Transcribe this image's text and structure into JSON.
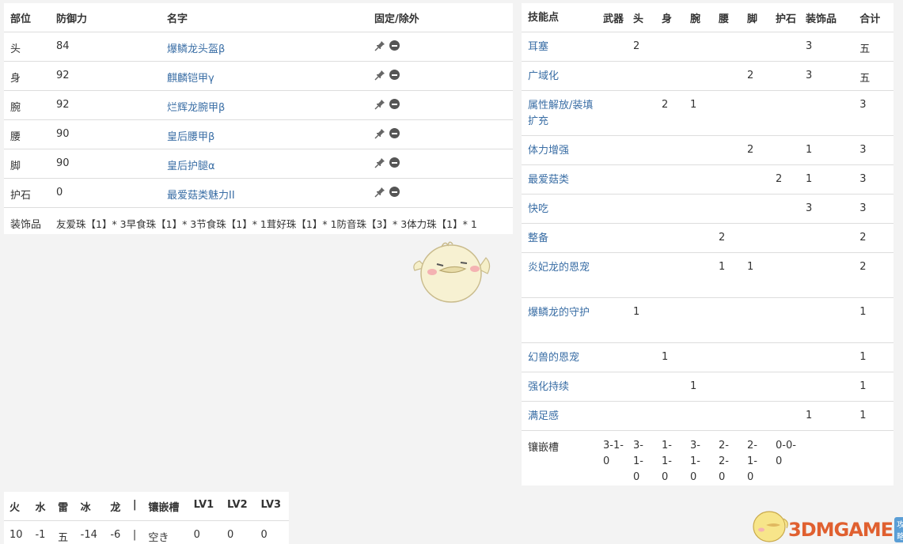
{
  "equipment": {
    "headers": [
      "部位",
      "防御力",
      "名字",
      "固定/除外"
    ],
    "rows": [
      {
        "part": "头",
        "defense": "84",
        "name": "爆鳞龙头盔β"
      },
      {
        "part": "身",
        "defense": "92",
        "name": "麒麟铠甲γ"
      },
      {
        "part": "腕",
        "defense": "92",
        "name": "烂辉龙腕甲β"
      },
      {
        "part": "腰",
        "defense": "90",
        "name": "皇后腰甲β"
      },
      {
        "part": "脚",
        "defense": "90",
        "name": "皇后护腿α"
      },
      {
        "part": "护石",
        "defense": "0",
        "name": "最爱菇类魅力II"
      }
    ],
    "deco_label": "装饰品",
    "deco_text": "友爱珠【1】* 3早食珠【1】* 3节食珠【1】* 1茸好珠【1】* 1防音珠【3】* 3体力珠【1】* 1"
  },
  "skills": {
    "headers": [
      "技能点",
      "武器",
      "头",
      "身",
      "腕",
      "腰",
      "脚",
      "护石",
      "装饰品",
      "合计"
    ],
    "rows": [
      {
        "name": "耳塞",
        "cells": [
          "",
          "2",
          "",
          "",
          "",
          "",
          "",
          "3",
          "五"
        ]
      },
      {
        "name": "广域化",
        "cells": [
          "",
          "",
          "",
          "",
          "",
          "2",
          "",
          "3",
          "五"
        ]
      },
      {
        "name": "属性解放/装填扩充",
        "cells": [
          "",
          "",
          "2",
          "1",
          "",
          "",
          "",
          "",
          "3"
        ]
      },
      {
        "name": "体力增强",
        "cells": [
          "",
          "",
          "",
          "",
          "",
          "2",
          "",
          "1",
          "3"
        ]
      },
      {
        "name": "最爱菇类",
        "cells": [
          "",
          "",
          "",
          "",
          "",
          "",
          "2",
          "1",
          "3"
        ]
      },
      {
        "name": "快吃",
        "cells": [
          "",
          "",
          "",
          "",
          "",
          "",
          "",
          "3",
          "3"
        ]
      },
      {
        "name": "整备",
        "cells": [
          "",
          "",
          "",
          "",
          "2",
          "",
          "",
          "",
          "2"
        ]
      },
      {
        "name": "炎妃龙的恩宠",
        "cells": [
          "",
          "",
          "",
          "",
          "1",
          "1",
          "",
          "",
          "2"
        ]
      },
      {
        "name": "爆鳞龙的守护",
        "cells": [
          "",
          "1",
          "",
          "",
          "",
          "",
          "",
          "",
          "1"
        ]
      },
      {
        "name": "幻兽的恩宠",
        "cells": [
          "",
          "",
          "1",
          "",
          "",
          "",
          "",
          "",
          "1"
        ]
      },
      {
        "name": "强化持续",
        "cells": [
          "",
          "",
          "",
          "1",
          "",
          "",
          "",
          "",
          "1"
        ]
      },
      {
        "name": "满足感",
        "cells": [
          "",
          "",
          "",
          "",
          "",
          "",
          "",
          "1",
          "1"
        ]
      }
    ],
    "slots_label": "镶嵌槽",
    "slots": [
      "3-1-0",
      "3-1-0",
      "1-1-0",
      "3-1-0",
      "2-2-0",
      "2-1-0",
      "0-0-0"
    ]
  },
  "resist": {
    "headers": [
      "火",
      "水",
      "雷",
      "冰",
      "龙",
      "|",
      "镶嵌槽",
      "LV1",
      "LV2",
      "LV3"
    ],
    "values": [
      "10",
      "-1",
      "五",
      "-14",
      "-6",
      "|",
      "空き",
      "0",
      "0",
      "0"
    ]
  },
  "watermark": {
    "brand": "3DMGAME",
    "sub": "攻略"
  },
  "icons": {
    "pin": "pin-icon",
    "exclude": "minus-circle-icon"
  }
}
